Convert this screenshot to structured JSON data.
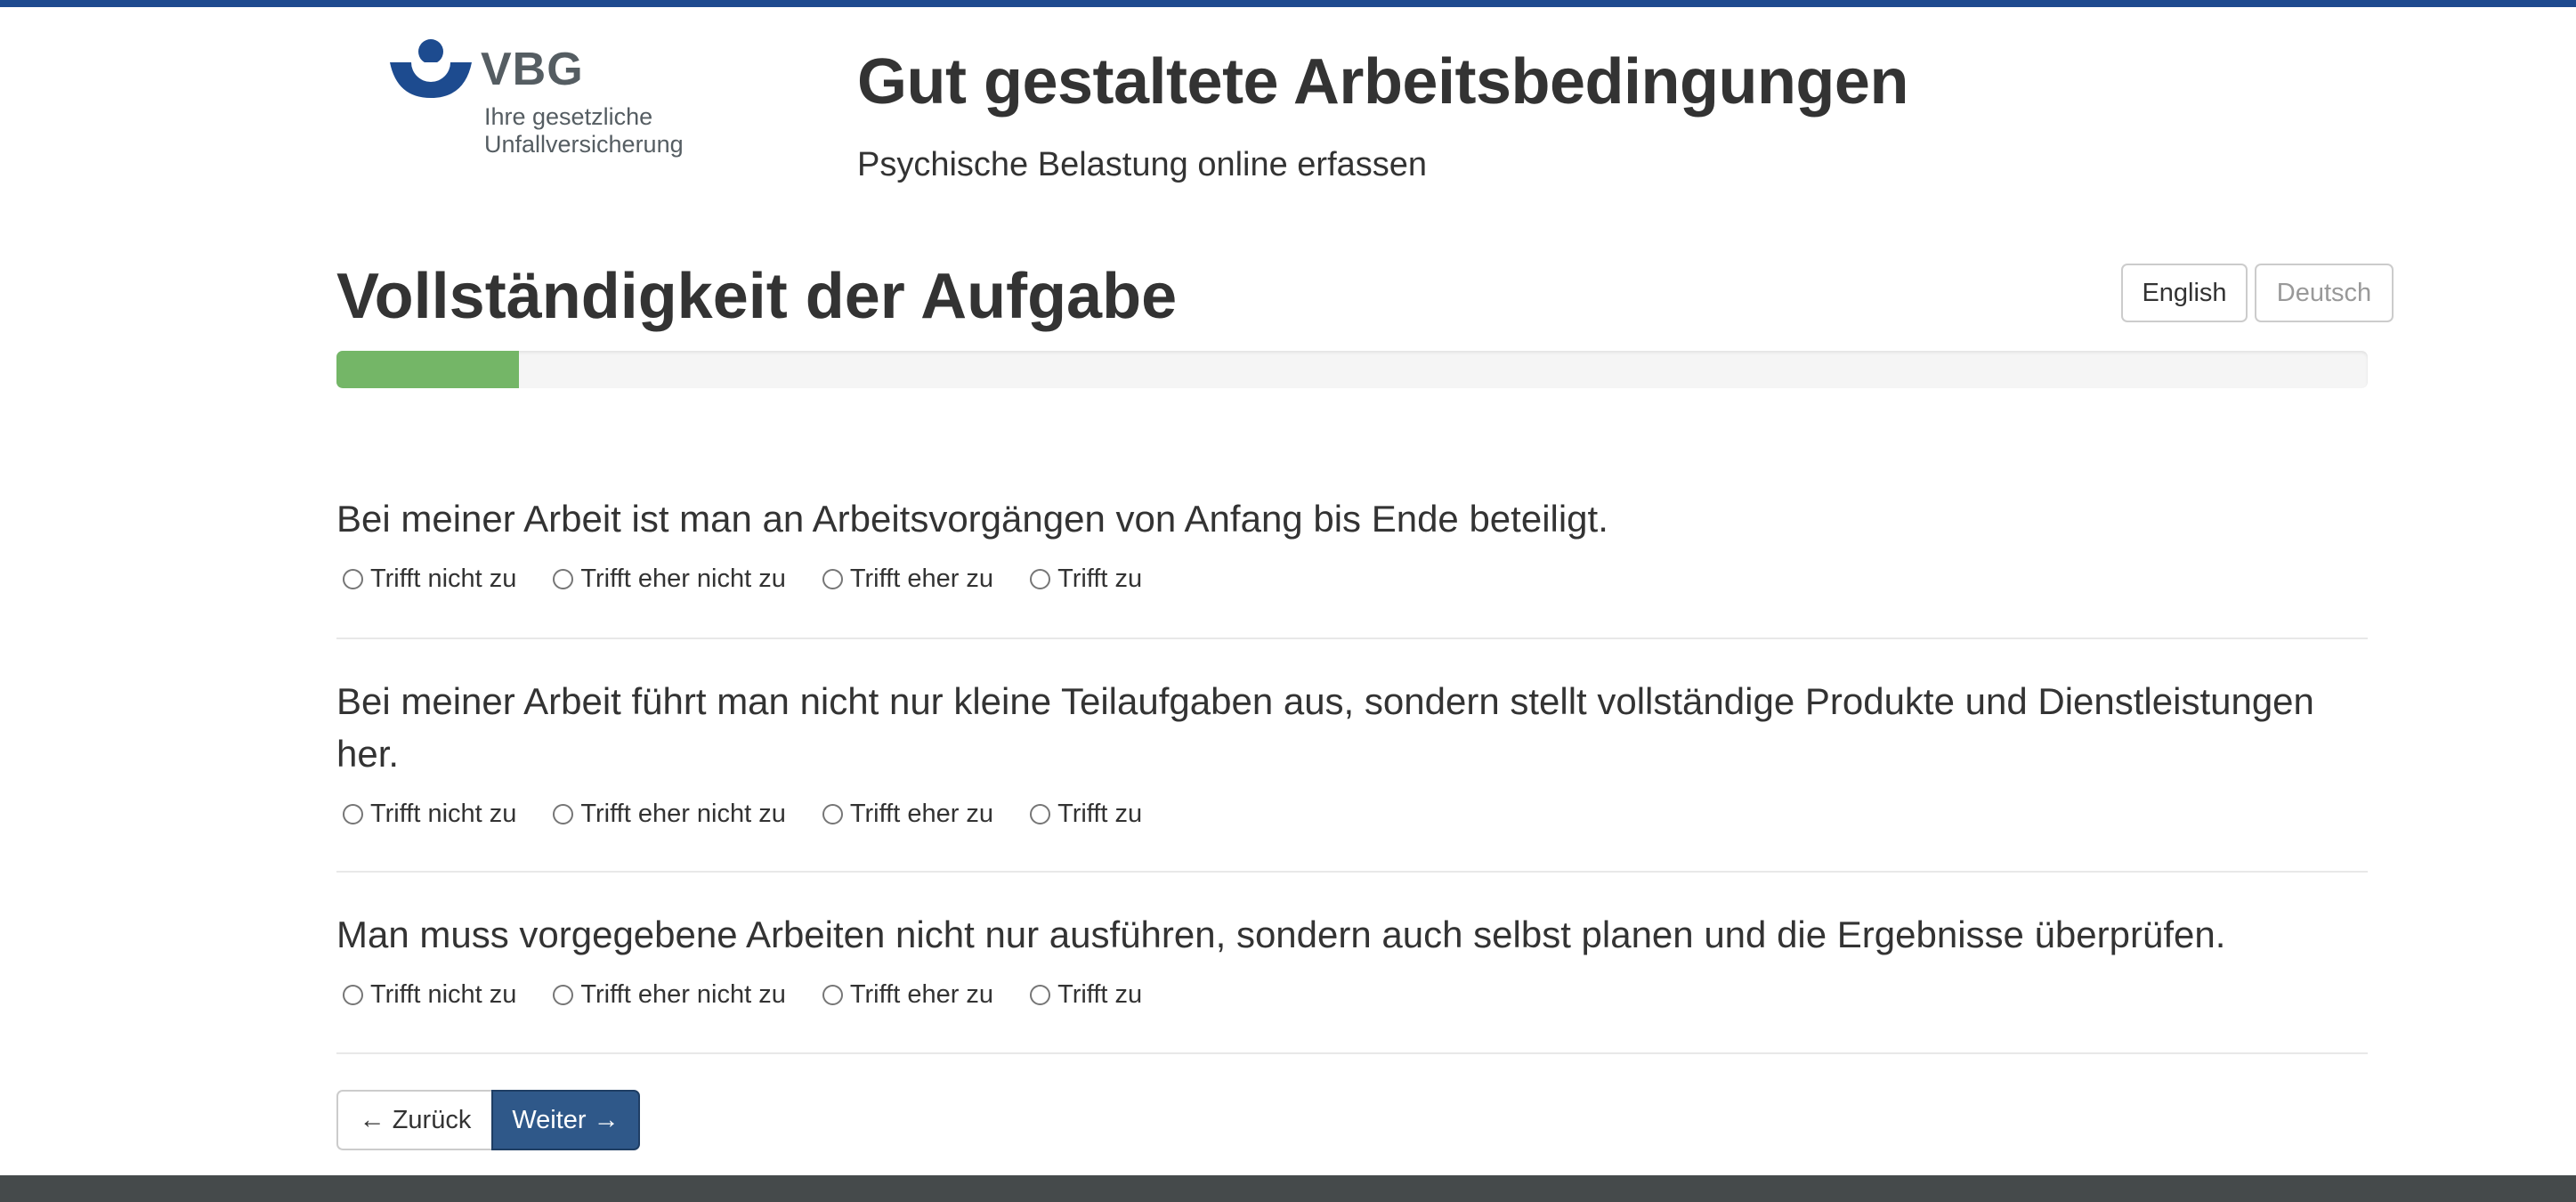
{
  "header": {
    "logo": {
      "name": "VBG",
      "tagline_line1": "Ihre gesetzliche",
      "tagline_line2": "Unfallversicherung"
    },
    "title": "Gut gestaltete Arbeitsbedingungen",
    "subtitle": "Psychische Belastung online erfassen"
  },
  "page": {
    "title": "Vollständigkeit der Aufgabe"
  },
  "language": {
    "english_label": "English",
    "deutsch_label": "Deutsch",
    "active": "English"
  },
  "progress": {
    "fraction": 0.09
  },
  "questions": [
    {
      "text": "Bei meiner Arbeit ist man an Arbeitsvorgängen von Anfang bis Ende beteiligt.",
      "options": [
        "Trifft nicht zu",
        "Trifft eher nicht zu",
        "Trifft eher zu",
        "Trifft zu"
      ]
    },
    {
      "text": "Bei meiner Arbeit führt man nicht nur kleine Teilaufgaben aus, sondern stellt vollständige Produkte und Dienstleistungen her.",
      "options": [
        "Trifft nicht zu",
        "Trifft eher nicht zu",
        "Trifft eher zu",
        "Trifft zu"
      ]
    },
    {
      "text": "Man muss vorgegebene Arbeiten nicht nur ausführen, sondern auch selbst planen und die Ergebnisse überprüfen.",
      "options": [
        "Trifft nicht zu",
        "Trifft eher nicht zu",
        "Trifft eher zu",
        "Trifft zu"
      ]
    }
  ],
  "navigation": {
    "back_label": "← Zurück",
    "next_label": "Weiter →"
  },
  "colors": {
    "top_strip": "#1e4a8f",
    "progress_fill": "#74b667",
    "primary_button": "#2f5889",
    "footer_band": "#454a4b",
    "logo_blue": "#1d4b8f",
    "logo_gray": "#555d62"
  },
  "icons": {
    "logo_mark": "vbg-logo-icon"
  }
}
